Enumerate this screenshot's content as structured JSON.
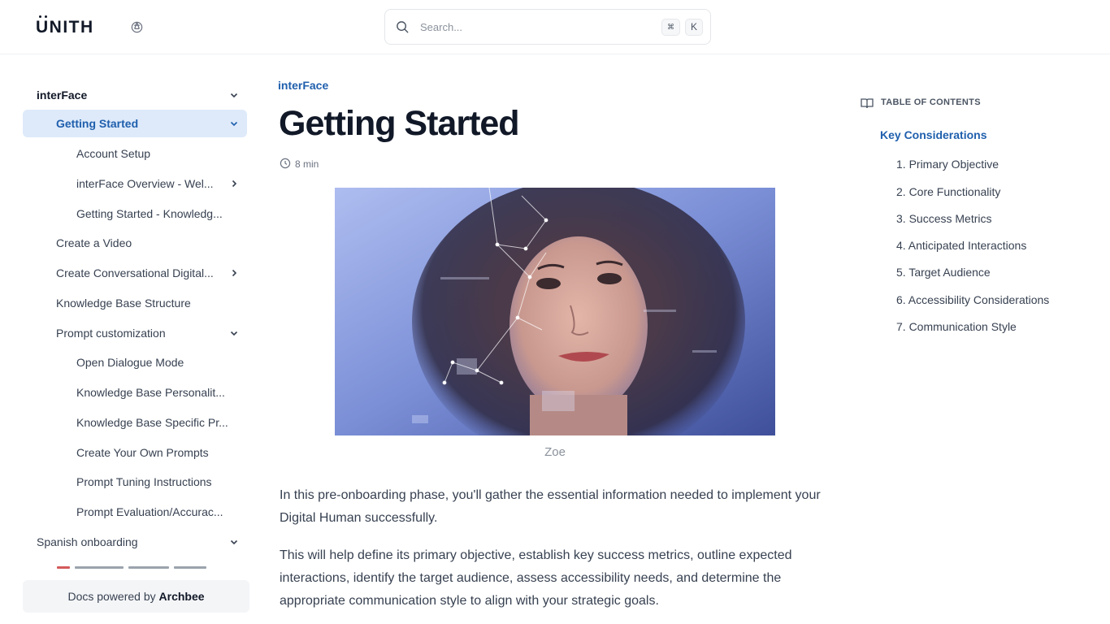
{
  "header": {
    "logo": "UNITH",
    "search": {
      "placeholder": "Search...",
      "shortcut_mod": "⌘",
      "shortcut_key": "K"
    }
  },
  "sidebar": {
    "items": [
      {
        "label": "interFace",
        "level": 0,
        "expanded": true,
        "section": true
      },
      {
        "label": "Getting Started",
        "level": 1,
        "expanded": true,
        "active": true
      },
      {
        "label": "Account Setup",
        "level": 2
      },
      {
        "label": "interFace Overview - Wel...",
        "level": 2,
        "has_children": true
      },
      {
        "label": "Getting Started - Knowledg...",
        "level": 2
      },
      {
        "label": "Create a Video",
        "level": 1
      },
      {
        "label": "Create Conversational Digital...",
        "level": 1,
        "has_children": true
      },
      {
        "label": "Knowledge Base Structure",
        "level": 1
      },
      {
        "label": "Prompt customization",
        "level": 1,
        "expanded": true
      },
      {
        "label": "Open Dialogue Mode",
        "level": 2
      },
      {
        "label": "Knowledge Base Personalit...",
        "level": 2
      },
      {
        "label": "Knowledge Base Specific Pr...",
        "level": 2
      },
      {
        "label": "Create Your Own Prompts",
        "level": 2
      },
      {
        "label": "Prompt Tuning Instructions",
        "level": 2
      },
      {
        "label": "Prompt Evaluation/Accurac...",
        "level": 2
      },
      {
        "label": "Spanish onboarding",
        "level": 0,
        "expanded": true
      }
    ],
    "powered_prefix": "Docs powered by",
    "powered_brand": "Archbee"
  },
  "main": {
    "breadcrumb": "interFace",
    "title": "Getting Started",
    "read_time": "8 min",
    "image_caption": "Zoe",
    "paragraphs": [
      "In this pre-onboarding phase, you'll gather the essential information needed to implement your Digital Human successfully.",
      "This will help define its primary objective, establish key success metrics, outline expected interactions, identify the target audience, assess accessibility needs, and determine the appropriate communication style to align with your strategic goals."
    ]
  },
  "toc": {
    "heading": "TABLE OF CONTENTS",
    "main": "Key Considerations",
    "items": [
      "1. Primary Objective",
      "2. Core Functionality",
      "3. Success Metrics",
      "4. Anticipated Interactions",
      "5. Target Audience",
      "6. Accessibility Considerations",
      "7. Communication Style"
    ]
  },
  "colors": {
    "accent": "#1f5fad",
    "active_bg": "#deeafa",
    "text": "#374151"
  },
  "icons": [
    "theme-toggle-icon",
    "search-icon",
    "chevron-down-icon",
    "chevron-right-icon",
    "clock-icon",
    "book-icon"
  ]
}
